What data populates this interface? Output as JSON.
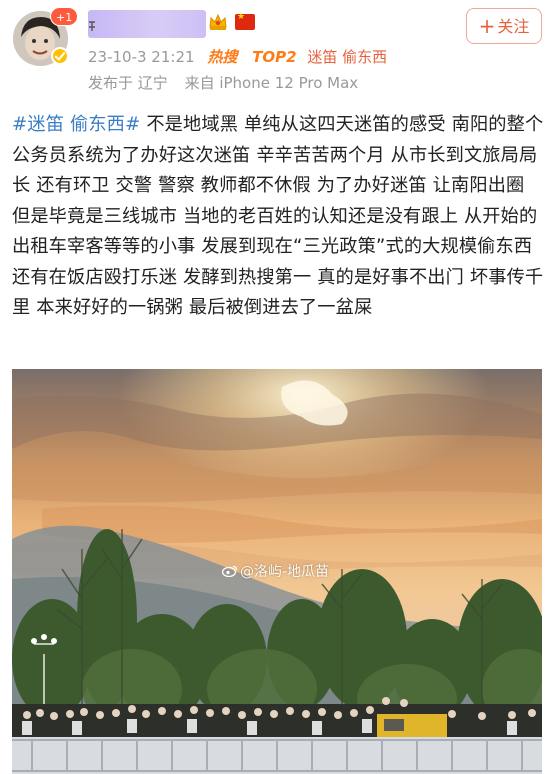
{
  "header": {
    "plus_badge": "+1",
    "follow_label": "关注",
    "follow_plus": "+",
    "timestamp": "23-10-3 21:21",
    "hot_search_label": "热搜",
    "rank_label": "TOP2",
    "hot_topic": "迷笛 偷东西",
    "location": "发布于 辽宁",
    "device": "来自 iPhone 12 Pro Max"
  },
  "post": {
    "hashtag": "#迷笛 偷东西#",
    "body": " 不是地域黑 单纯从这四天迷笛的感受 南阳的整个公务员系统为了办好这次迷笛 辛辛苦苦两个月 从市长到文旅局局长  还有环卫 交警 警察 教师都不休假 为了办好迷笛 让南阳出圈  但是毕竟是三线城市 当地的老百姓的认知还是没有跟上 从开始的出租车宰客等等的小事 发展到现在“三光政策”式的大规模偷东西 还有在饭店殴打乐迷 发酵到热搜第一 真的是好事不出门 坏事传千里 本来好好的一锅粥 最后被倒进去了一盆屎"
  },
  "photo": {
    "watermark": "@洛屿-地瓜苗"
  },
  "colors": {
    "accent_orange": "#e8613f",
    "hot_orange": "#ff7b17",
    "link_blue": "#3b7ec4",
    "meta_gray": "#999999"
  },
  "icons": [
    "crown-icon",
    "china-flag-icon",
    "verified-icon",
    "weibo-watermark-icon"
  ]
}
